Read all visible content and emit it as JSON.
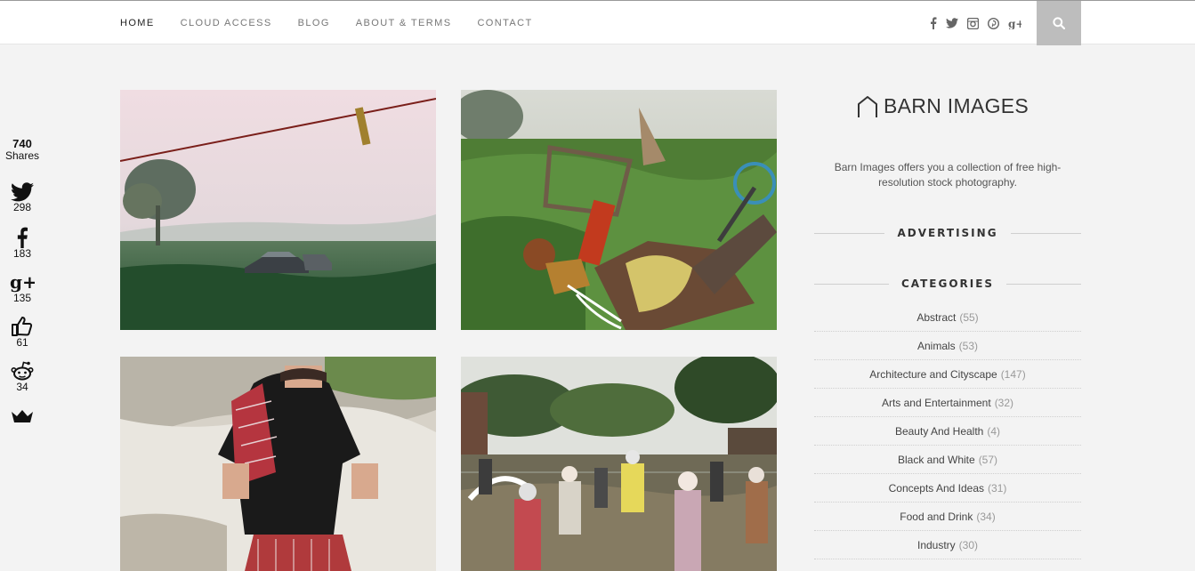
{
  "nav": {
    "items": [
      {
        "label": "HOME",
        "active": true
      },
      {
        "label": "CLOUD ACCESS",
        "active": false
      },
      {
        "label": "BLOG",
        "active": false
      },
      {
        "label": "ABOUT & TERMS",
        "active": false
      },
      {
        "label": "CONTACT",
        "active": false
      }
    ],
    "social_icons": [
      "facebook-icon",
      "twitter-icon",
      "instagram-icon",
      "pinterest-icon",
      "google-plus-icon"
    ],
    "search_icon": "search-icon"
  },
  "share_bar": {
    "total": "740",
    "total_label": "Shares",
    "items": [
      {
        "network": "twitter",
        "count": "298"
      },
      {
        "network": "facebook",
        "count": "183"
      },
      {
        "network": "google-plus",
        "count": "135"
      },
      {
        "network": "like",
        "count": "61"
      },
      {
        "network": "reddit",
        "count": "34"
      },
      {
        "network": "crown",
        "count": ""
      }
    ]
  },
  "sidebar": {
    "brand": "BARN IMAGES",
    "about": "Barn Images offers you a collection of free high-resolution stock photography.",
    "advertising_heading": "ADVERTISING",
    "categories_heading": "CATEGORIES",
    "categories": [
      {
        "name": "Abstract",
        "count": "(55)"
      },
      {
        "name": "Animals",
        "count": "(53)"
      },
      {
        "name": "Architecture and Cityscape",
        "count": "(147)"
      },
      {
        "name": "Arts and Entertainment",
        "count": "(32)"
      },
      {
        "name": "Beauty And Health",
        "count": "(4)"
      },
      {
        "name": "Black and White",
        "count": "(57)"
      },
      {
        "name": "Concepts And Ideas",
        "count": "(31)"
      },
      {
        "name": "Food and Drink",
        "count": "(34)"
      },
      {
        "name": "Industry",
        "count": "(30)"
      }
    ]
  },
  "colors": {
    "page_bg": "#f3f3f3",
    "search_button": "#bdbdbd",
    "text": "#333333"
  }
}
